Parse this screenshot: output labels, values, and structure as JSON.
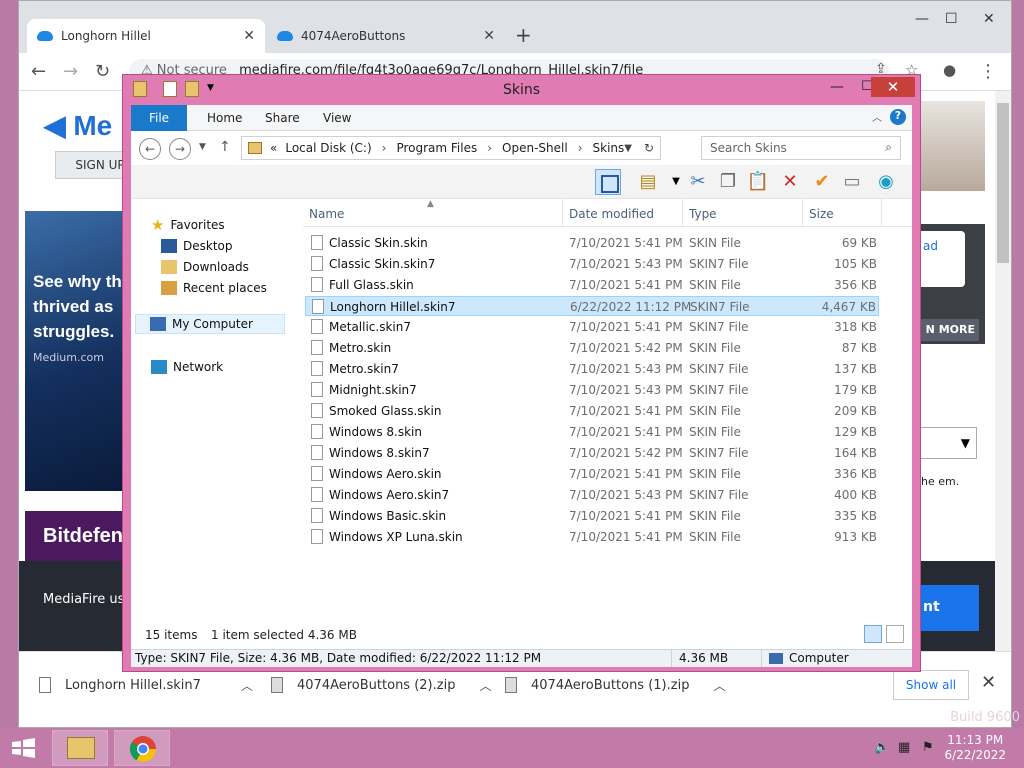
{
  "chrome": {
    "tabs": [
      {
        "title": "Longhorn Hillel",
        "active": true
      },
      {
        "title": "4074AeroButtons",
        "active": false
      }
    ],
    "omnibox": {
      "security": "Not secure",
      "url": "mediafire.com/file/fq4t3o0age69g7c/Longhorn_Hillel.skin7/file"
    },
    "page": {
      "logo": "Me",
      "signup": "SIGN UP",
      "ad_medium_text": "See why th thrived as struggles.",
      "ad_medium_source": "Medium.com",
      "ad_bitdef": "Bitdefen",
      "cookie_text": "MediaFire use agree to our P",
      "right_white": "ad",
      "right_btn": "N MORE",
      "right_note": "he em.",
      "right_blue": "nt"
    },
    "downloads": [
      {
        "name": "Longhorn Hillel.skin7",
        "kind": "file"
      },
      {
        "name": "4074AeroButtons (2).zip",
        "kind": "zip"
      },
      {
        "name": "4074AeroButtons (1).zip",
        "kind": "zip"
      }
    ],
    "show_all": "Show all"
  },
  "explorer": {
    "title": "Skins",
    "ribbon_tabs": [
      "File",
      "Home",
      "Share",
      "View"
    ],
    "breadcrumb": [
      "Local Disk (C:)",
      "Program Files",
      "Open-Shell",
      "Skins"
    ],
    "breadcrumb_prefix": "«",
    "search_placeholder": "Search Skins",
    "nav": {
      "favorites": "Favorites",
      "desktop": "Desktop",
      "downloads": "Downloads",
      "recent": "Recent places",
      "mycomputer": "My Computer",
      "network": "Network"
    },
    "columns": [
      "Name",
      "Date modified",
      "Type",
      "Size"
    ],
    "files": [
      {
        "name": "Classic Skin.skin",
        "date": "7/10/2021 5:41 PM",
        "type": "SKIN File",
        "size": "69 KB",
        "selected": false
      },
      {
        "name": "Classic Skin.skin7",
        "date": "7/10/2021 5:43 PM",
        "type": "SKIN7 File",
        "size": "105 KB",
        "selected": false
      },
      {
        "name": "Full Glass.skin",
        "date": "7/10/2021 5:41 PM",
        "type": "SKIN File",
        "size": "356 KB",
        "selected": false
      },
      {
        "name": "Longhorn Hillel.skin7",
        "date": "6/22/2022 11:12 PM",
        "type": "SKIN7 File",
        "size": "4,467 KB",
        "selected": true
      },
      {
        "name": "Metallic.skin7",
        "date": "7/10/2021 5:41 PM",
        "type": "SKIN7 File",
        "size": "318 KB",
        "selected": false
      },
      {
        "name": "Metro.skin",
        "date": "7/10/2021 5:42 PM",
        "type": "SKIN File",
        "size": "87 KB",
        "selected": false
      },
      {
        "name": "Metro.skin7",
        "date": "7/10/2021 5:43 PM",
        "type": "SKIN7 File",
        "size": "137 KB",
        "selected": false
      },
      {
        "name": "Midnight.skin7",
        "date": "7/10/2021 5:43 PM",
        "type": "SKIN7 File",
        "size": "179 KB",
        "selected": false
      },
      {
        "name": "Smoked Glass.skin",
        "date": "7/10/2021 5:41 PM",
        "type": "SKIN File",
        "size": "209 KB",
        "selected": false
      },
      {
        "name": "Windows 8.skin",
        "date": "7/10/2021 5:41 PM",
        "type": "SKIN File",
        "size": "129 KB",
        "selected": false
      },
      {
        "name": "Windows 8.skin7",
        "date": "7/10/2021 5:42 PM",
        "type": "SKIN7 File",
        "size": "164 KB",
        "selected": false
      },
      {
        "name": "Windows Aero.skin",
        "date": "7/10/2021 5:41 PM",
        "type": "SKIN File",
        "size": "336 KB",
        "selected": false
      },
      {
        "name": "Windows Aero.skin7",
        "date": "7/10/2021 5:43 PM",
        "type": "SKIN7 File",
        "size": "400 KB",
        "selected": false
      },
      {
        "name": "Windows Basic.skin",
        "date": "7/10/2021 5:41 PM",
        "type": "SKIN File",
        "size": "335 KB",
        "selected": false
      },
      {
        "name": "Windows XP Luna.skin",
        "date": "7/10/2021 5:41 PM",
        "type": "SKIN File",
        "size": "913 KB",
        "selected": false
      }
    ],
    "status": {
      "count": "15 items",
      "selection": "1 item selected  4.36 MB"
    },
    "details": {
      "info": "Type: SKIN7 File, Size: 4.36 MB, Date modified: 6/22/2022 11:12 PM",
      "size": "4.36 MB",
      "location": "Computer"
    }
  },
  "taskbar": {
    "time": "11:13 PM",
    "date": "6/22/2022",
    "build": "Build 9600"
  },
  "colors": {
    "explorer_frame": "#e07bb4",
    "close_red": "#c7403a",
    "selection": "#cce8ff",
    "accent_blue": "#1979ca"
  }
}
